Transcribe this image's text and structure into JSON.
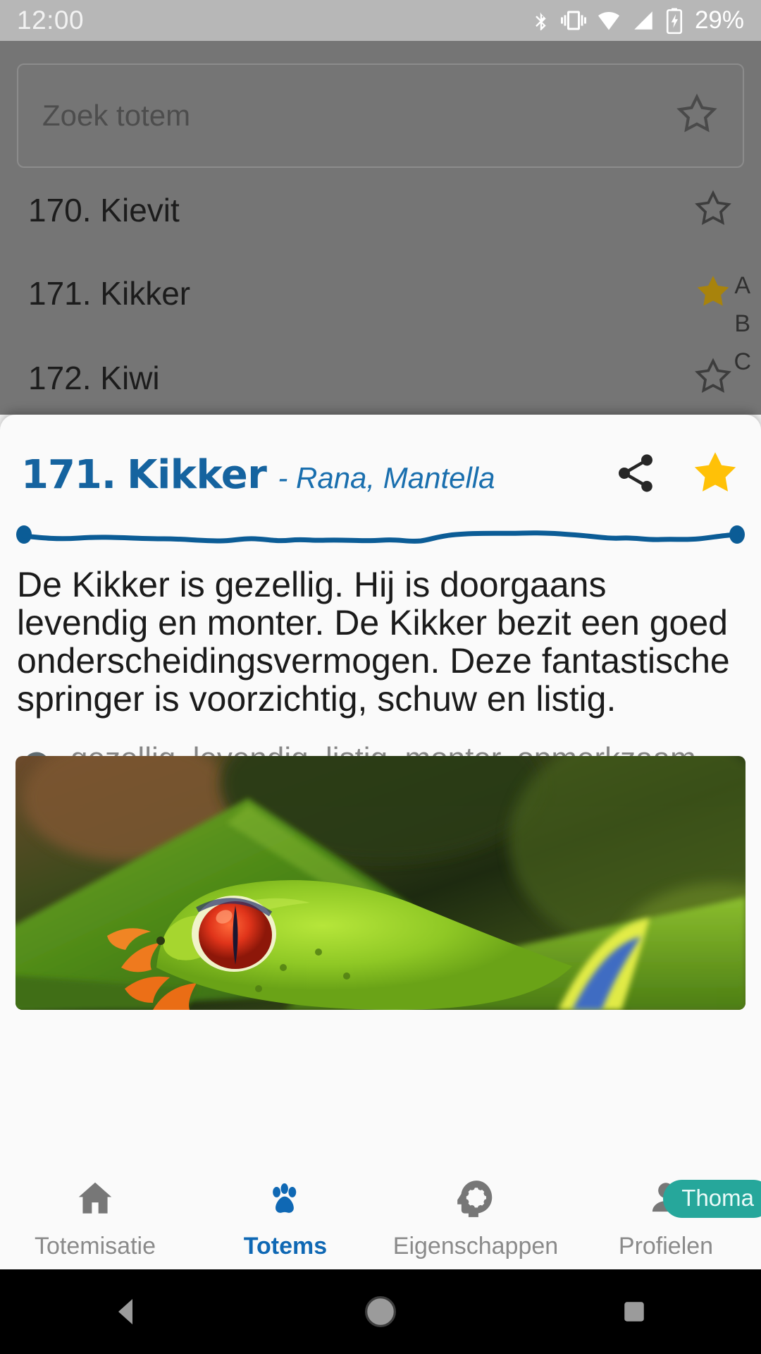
{
  "status_bar": {
    "time": "12:00",
    "battery_percent": "29%",
    "icons": [
      "bluetooth-icon",
      "vibrate-icon",
      "wifi-icon",
      "signal-icon",
      "battery-charging-icon"
    ]
  },
  "background_list": {
    "search": {
      "placeholder": "Zoek totem",
      "star_icon": "star-outline-icon"
    },
    "rows": [
      {
        "label": "170. Kievit",
        "favorite": false
      },
      {
        "label": "171. Kikker",
        "favorite": true
      },
      {
        "label": "172. Kiwi",
        "favorite": false
      }
    ],
    "alphabet_index": [
      "A",
      "B",
      "C"
    ]
  },
  "detail_card": {
    "number": "171.",
    "name": "Kikker",
    "latin": "- Rana, Mantella",
    "share_icon": "share-icon",
    "favorite_icon": "star-filled-icon",
    "favorite": true,
    "description": "De Kikker is gezellig. Hij is doorgaans levendig en monter. De Kikker bezit een goed onderscheidingsvermogen. Deze fantastische springer is voorzichtig, schuw en listig.",
    "keywords_icon": "psychology-head-gear-icon",
    "keywords": "gezellig, levendig, listig, monter, opmerkzaam, schuw, voorzichtig",
    "photo_alt": "red-eyed-tree-frog-photo"
  },
  "bottom_nav": {
    "items": [
      {
        "label": "Totemisatie",
        "icon": "home-icon",
        "active": false
      },
      {
        "label": "Totems",
        "icon": "paw-icon",
        "active": true
      },
      {
        "label": "Eigenschappen",
        "icon": "psychology-head-gear-icon",
        "active": false
      },
      {
        "label": "Profielen",
        "icon": "person-icon",
        "active": false
      }
    ],
    "profile_badge": "Thoma"
  },
  "android_nav": {
    "back": "back-triangle-icon",
    "home": "home-circle-icon",
    "recents": "recents-square-icon"
  },
  "colors": {
    "accent_blue": "#15639f",
    "nav_active_blue": "#0f68b4",
    "star_gold": "#FFC107",
    "star_gold_dim": "#a8830c",
    "badge_teal": "#26a79b",
    "card_bg": "#fafafa",
    "dim_overlay": "#757575",
    "status_bar_bg": "#b7b7b7"
  }
}
